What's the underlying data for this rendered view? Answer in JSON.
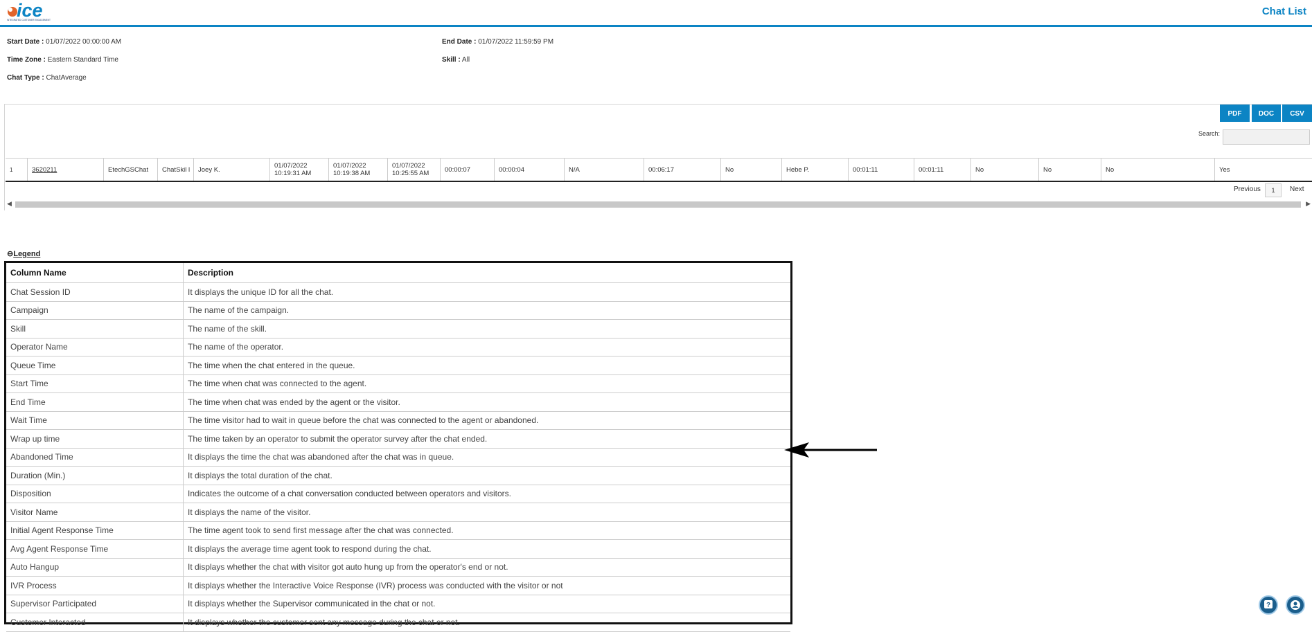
{
  "header": {
    "logo_text": "ice",
    "logo_tagline": "INTEGRATED CUSTOMER ENGAGEMENT",
    "title": "Chat List"
  },
  "filters": {
    "start_date_label": "Start Date :",
    "start_date": "01/07/2022 00:00:00 AM",
    "end_date_label": "End Date :",
    "end_date": "01/07/2022 11:59:59 PM",
    "time_zone_label": "Time Zone :",
    "time_zone": "Eastern Standard Time",
    "skill_label": "Skill :",
    "skill": "All",
    "chat_type_label": "Chat Type :",
    "chat_type": "ChatAverage"
  },
  "export": {
    "pdf": "PDF",
    "doc": "DOC",
    "csv": "CSV"
  },
  "search": {
    "label": "Search:",
    "value": ""
  },
  "row": {
    "index": "1",
    "session_id": "3620211",
    "campaign": "EtechGSChat",
    "skill": "ChatSkil l",
    "operator": "Joey K.",
    "queue_time": "01/07/2022 10:19:31 AM",
    "start_time": "01/07/2022 10:19:38 AM",
    "end_time": "01/07/2022 10:25:55 AM",
    "wait_time": "00:00:07",
    "wrap_up": "00:00:04",
    "abandoned": "N/A",
    "duration": "00:06:17",
    "disposition": "No",
    "visitor": "Hebe P.",
    "initial_resp": "00:01:11",
    "avg_resp": "00:01:11",
    "auto_hangup": "No",
    "ivr": "No",
    "supervisor": "No",
    "customer_interacted": "Yes"
  },
  "pager": {
    "previous": "Previous",
    "page": "1",
    "next": "Next"
  },
  "legend": {
    "toggle": "Legend",
    "col_header": "Column Name",
    "desc_header": "Description",
    "rows": [
      {
        "name": "Chat Session ID",
        "desc": "It displays the unique ID for all the chat."
      },
      {
        "name": "Campaign",
        "desc": "The name of the campaign."
      },
      {
        "name": "Skill",
        "desc": "The name of the skill."
      },
      {
        "name": "Operator Name",
        "desc": "The name of the operator."
      },
      {
        "name": "Queue Time",
        "desc": "The time when the chat entered in the queue."
      },
      {
        "name": "Start Time",
        "desc": "The time when chat was connected to the agent."
      },
      {
        "name": "End Time",
        "desc": "The time when chat was ended by the agent or the visitor."
      },
      {
        "name": "Wait Time",
        "desc": "The time visitor had to wait in queue before the chat was connected to the agent or abandoned."
      },
      {
        "name": "Wrap up time",
        "desc": "The time taken by an operator to submit the operator survey after the chat ended."
      },
      {
        "name": "Abandoned Time",
        "desc": "It displays the time the chat was abandoned after the chat was in queue."
      },
      {
        "name": "Duration (Min.)",
        "desc": "It displays the total duration of the chat."
      },
      {
        "name": "Disposition",
        "desc": "Indicates the outcome of a chat conversation conducted between operators and visitors."
      },
      {
        "name": "Visitor Name",
        "desc": "It displays the name of the visitor."
      },
      {
        "name": "Initial Agent Response Time",
        "desc": "The time agent took to send first message after the chat was connected."
      },
      {
        "name": "Avg Agent Response Time",
        "desc": "It displays the average time agent took to respond during the chat."
      },
      {
        "name": "Auto Hangup",
        "desc": "It displays whether the chat with visitor got auto hung up from the operator's end or not."
      },
      {
        "name": "IVR Process",
        "desc": "It displays whether the Interactive Voice Response (IVR) process was conducted with the visitor or not"
      },
      {
        "name": "Supervisor Participated",
        "desc": "It displays whether the Supervisor communicated in the chat or not."
      },
      {
        "name": "Customer Interacted",
        "desc": "It displays whether the customer sent any message during the chat or not."
      }
    ]
  },
  "colors": {
    "accent": "#0c84c4"
  },
  "icons": {
    "help": "help-icon",
    "user": "user-icon",
    "arrow": "arrow-left-icon"
  }
}
